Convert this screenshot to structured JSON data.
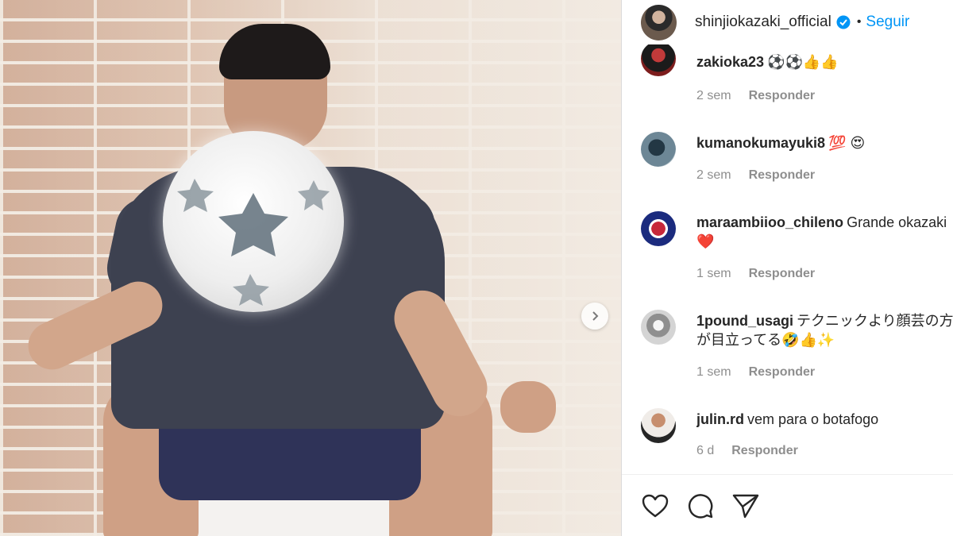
{
  "header": {
    "username": "shinjiokazaki_official",
    "separator": "•",
    "follow_label": "Seguir"
  },
  "comments": [
    {
      "username": "zakioka23",
      "text": "⚽⚽👍👍",
      "time": "2 sem",
      "reply": "Responder"
    },
    {
      "username": "kumanokumayuki8",
      "text": "💯 😍",
      "time": "2 sem",
      "reply": "Responder"
    },
    {
      "username": "maraambiioo_chileno",
      "text": "Grande okazaki ❤️",
      "time": "1 sem",
      "reply": "Responder"
    },
    {
      "username": "1pound_usagi",
      "text": "テクニックより顔芸の方が目立ってる🤣👍✨",
      "time": "1 sem",
      "reply": "Responder"
    },
    {
      "username": "julin.rd",
      "text": "vem para o botafogo",
      "time": "6 d",
      "reply": "Responder"
    }
  ],
  "colors": {
    "link_blue": "#0095f6",
    "text": "#262626",
    "muted": "#8e8e8e",
    "border": "#dbdbdb"
  },
  "icons": {
    "verified": "verified-badge-icon",
    "like": "heart-icon",
    "comment": "comment-bubble-icon",
    "share": "paper-plane-icon",
    "next": "chevron-right-icon"
  }
}
